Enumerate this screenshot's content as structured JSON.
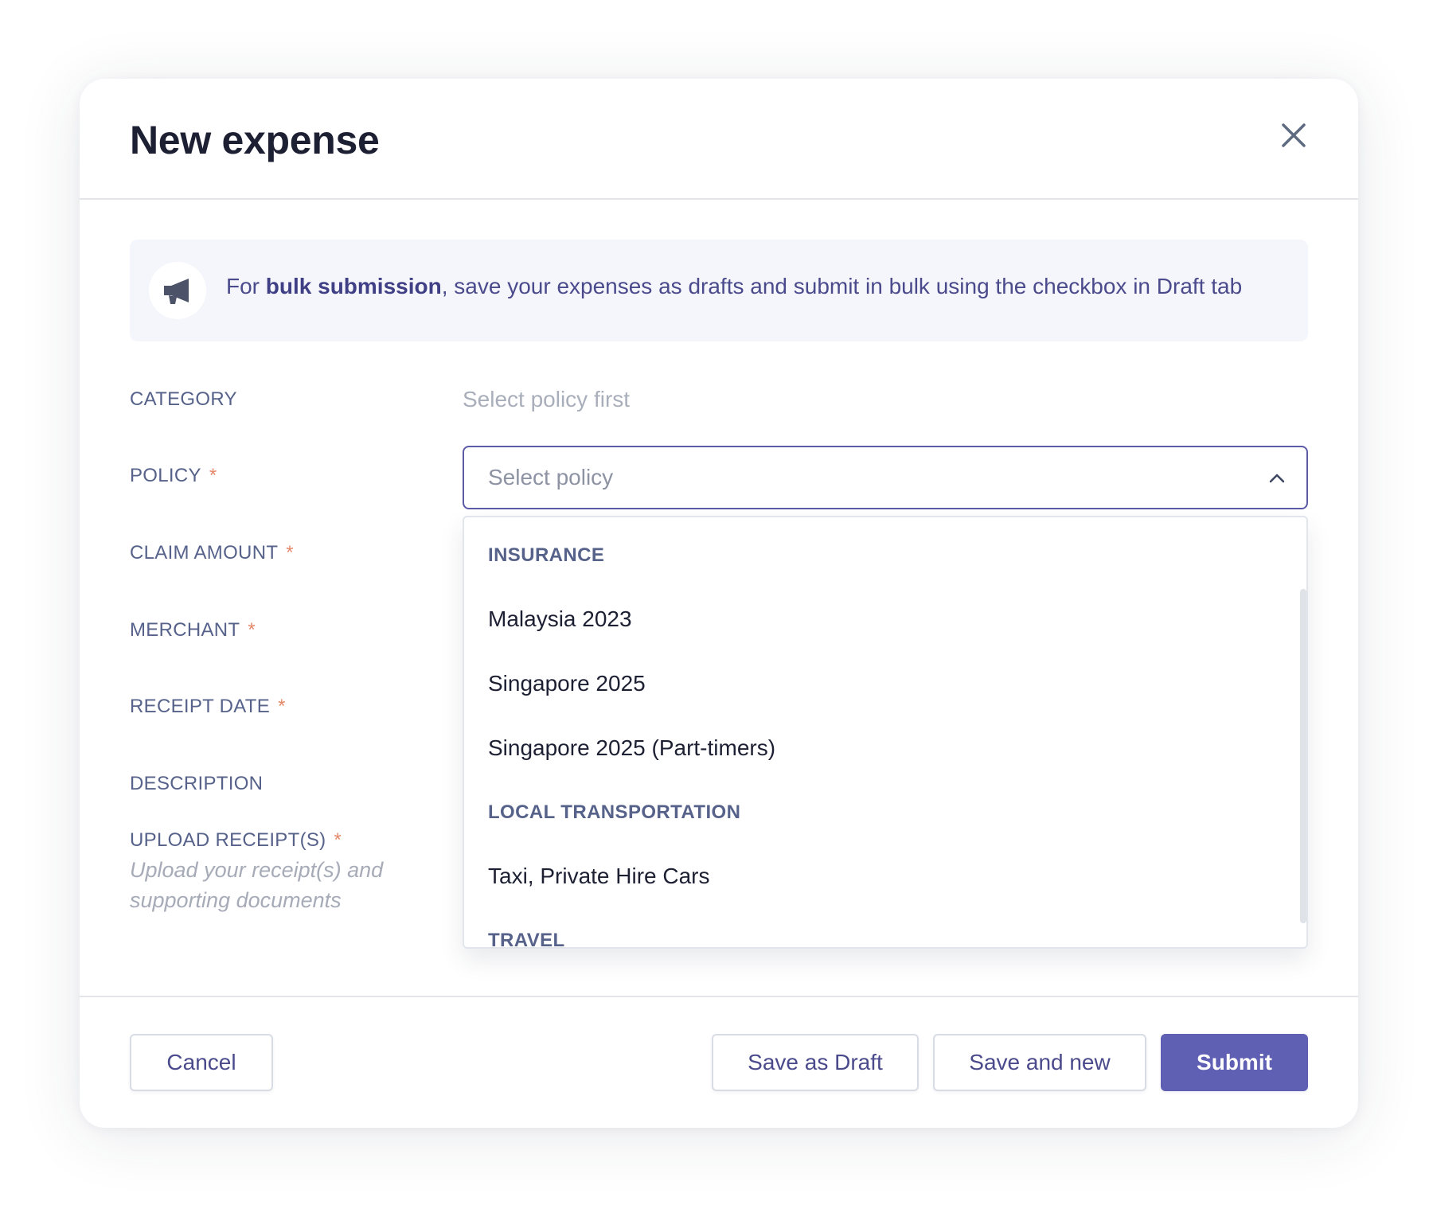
{
  "modal": {
    "title": "New expense"
  },
  "banner": {
    "icon": "megaphone-icon",
    "text_prefix": "For ",
    "text_bold": "bulk submission",
    "text_suffix": ", save your expenses as drafts and submit in bulk using the checkbox in Draft tab"
  },
  "fields": {
    "category": {
      "label": "CATEGORY",
      "value": "Select policy first"
    },
    "policy": {
      "label": "POLICY",
      "required_mark": "*",
      "placeholder": "Select policy"
    },
    "claim_amount": {
      "label": "CLAIM AMOUNT",
      "required_mark": "*"
    },
    "merchant": {
      "label": "MERCHANT",
      "required_mark": "*"
    },
    "receipt_date": {
      "label": "RECEIPT DATE",
      "required_mark": "*"
    },
    "description": {
      "label": "DESCRIPTION"
    },
    "upload": {
      "label": "UPLOAD RECEIPT(S)",
      "required_mark": "*",
      "hint": "Upload your receipt(s) and supporting documents"
    }
  },
  "policy_dropdown": {
    "groups": [
      {
        "label": "INSURANCE",
        "options": [
          "Malaysia 2023",
          "Singapore 2025",
          "Singapore 2025 (Part-timers)"
        ]
      },
      {
        "label": "LOCAL TRANSPORTATION",
        "options": [
          "Taxi, Private Hire Cars"
        ]
      },
      {
        "label": "TRAVEL",
        "options": []
      }
    ]
  },
  "footer": {
    "cancel_label": "Cancel",
    "save_draft_label": "Save as Draft",
    "save_new_label": "Save and new",
    "submit_label": "Submit"
  },
  "colors": {
    "accent": "#5f5fb3",
    "required": "#e6896a",
    "label": "#56628a",
    "title": "#1d2033"
  }
}
